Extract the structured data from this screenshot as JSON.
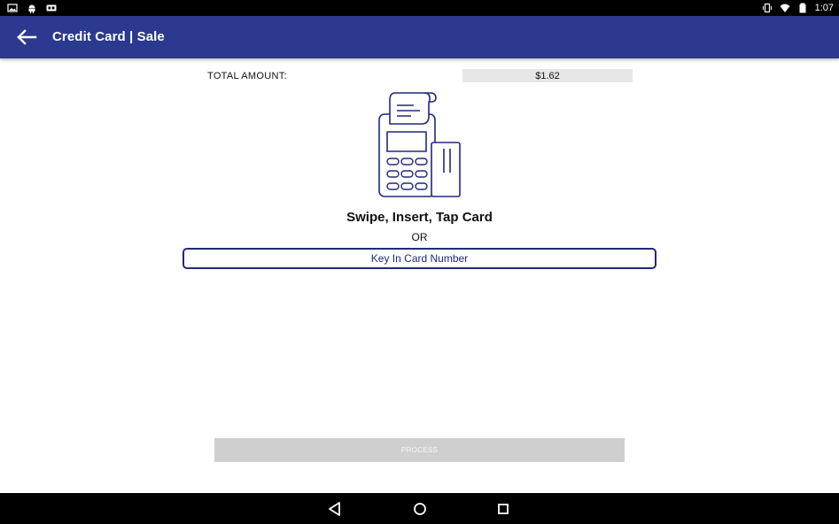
{
  "status_bar": {
    "time": "1:07",
    "left_icons": [
      "image-icon",
      "android-icon",
      "gif-icon"
    ],
    "right_icons": [
      "vibrate-icon",
      "wifi-icon",
      "battery-icon"
    ]
  },
  "app_bar": {
    "title": "Credit Card | Sale",
    "back_icon": "arrow-back-icon",
    "background": "#2b3990"
  },
  "total": {
    "label": "TOTAL AMOUNT:",
    "value": "$1.62"
  },
  "card_reader": {
    "icon": "card-terminal-icon",
    "prompt": "Swipe, Insert, Tap Card",
    "or_text": "OR"
  },
  "key_in_button": {
    "label": "Key In Card Number",
    "color": "#1f2a78"
  },
  "process_button": {
    "label": "PROCESS",
    "enabled": false
  },
  "nav_bar": {
    "icons": [
      "back-triangle-icon",
      "home-circle-icon",
      "recents-square-icon"
    ]
  }
}
